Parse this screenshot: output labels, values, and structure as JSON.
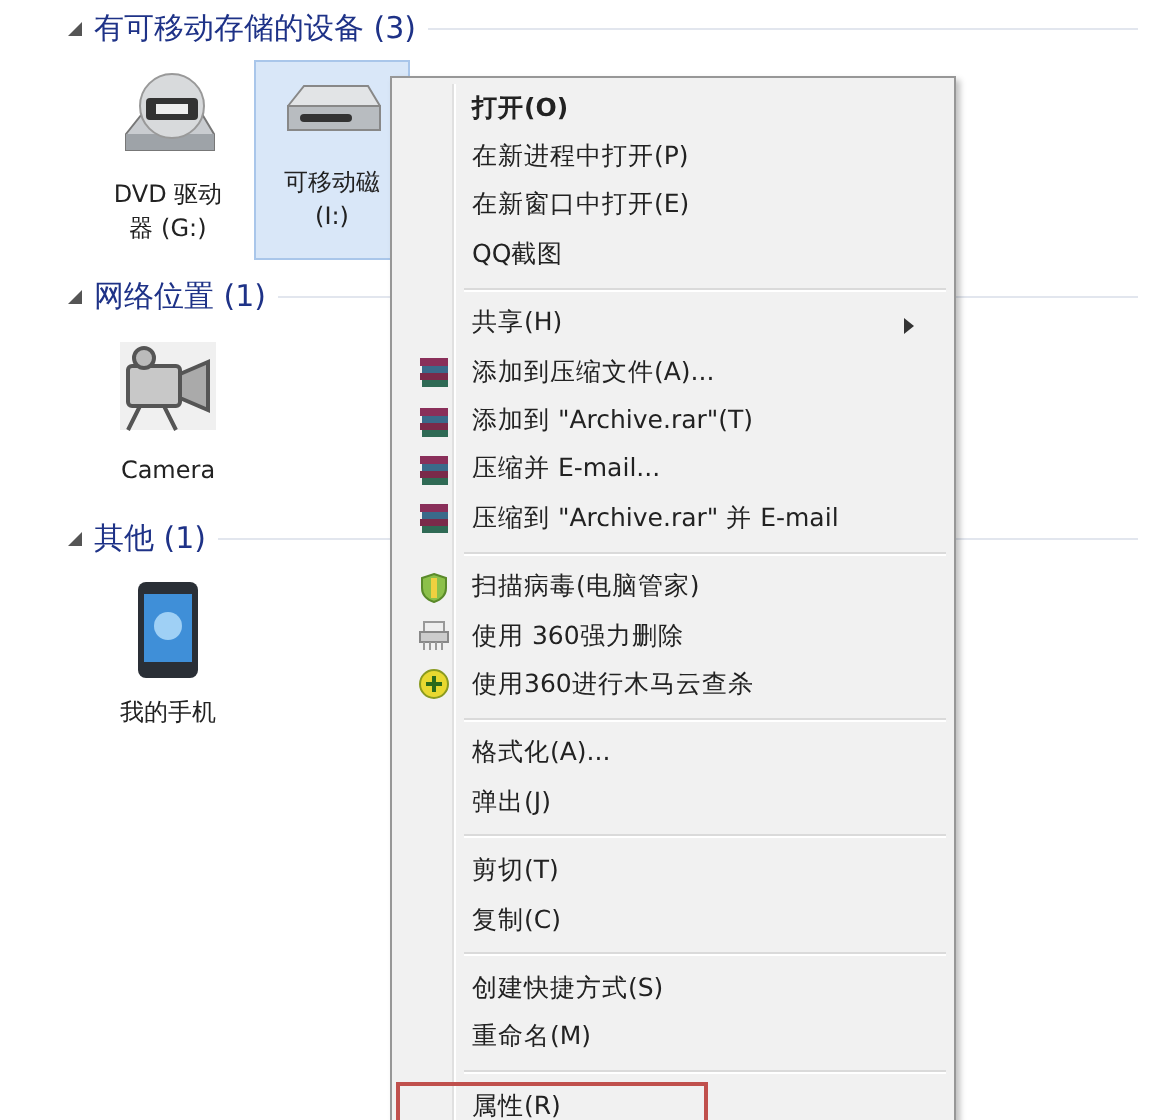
{
  "groups": [
    {
      "title": "有可移动存储的设备 (3)",
      "expanded": true,
      "items": [
        {
          "kind": "dvd",
          "lines": [
            "DVD 驱动",
            "器 (G:)"
          ],
          "selected": false
        },
        {
          "kind": "drive",
          "lines": [
            "可移动磁",
            "(I:)"
          ],
          "selected": true
        }
      ]
    },
    {
      "title": "网络位置 (1)",
      "expanded": true,
      "items": [
        {
          "kind": "camera",
          "lines": [
            "Camera"
          ],
          "selected": false
        }
      ]
    },
    {
      "title": "其他 (1)",
      "expanded": true,
      "items": [
        {
          "kind": "phone",
          "lines": [
            "我的手机"
          ],
          "selected": false
        }
      ]
    }
  ],
  "context_menu": [
    {
      "kind": "command",
      "label": "打开(O)",
      "default": true
    },
    {
      "kind": "command",
      "label": "在新进程中打开(P)"
    },
    {
      "kind": "command",
      "label": "在新窗口中打开(E)"
    },
    {
      "kind": "command",
      "label": "QQ截图"
    },
    {
      "kind": "separator"
    },
    {
      "kind": "command",
      "label": "共享(H)",
      "submenu": true
    },
    {
      "kind": "archive",
      "label": "添加到压缩文件(A)..."
    },
    {
      "kind": "archive",
      "label": "添加到 \"Archive.rar\"(T)"
    },
    {
      "kind": "archive",
      "label": "压缩并 E-mail..."
    },
    {
      "kind": "archive",
      "label": "压缩到 \"Archive.rar\" 并 E-mail"
    },
    {
      "kind": "separator"
    },
    {
      "kind": "shield",
      "label": "扫描病毒(电脑管家)"
    },
    {
      "kind": "shredder",
      "label": "使用 360强力删除"
    },
    {
      "kind": "plus",
      "label": "使用360进行木马云查杀"
    },
    {
      "kind": "separator"
    },
    {
      "kind": "command",
      "label": "格式化(A)..."
    },
    {
      "kind": "command",
      "label": "弹出(J)"
    },
    {
      "kind": "separator"
    },
    {
      "kind": "command",
      "label": "剪切(T)"
    },
    {
      "kind": "command",
      "label": "复制(C)"
    },
    {
      "kind": "separator"
    },
    {
      "kind": "command",
      "label": "创建快捷方式(S)"
    },
    {
      "kind": "command",
      "label": "重命名(M)"
    },
    {
      "kind": "separator"
    },
    {
      "kind": "command",
      "label": "属性(R)",
      "highlighted": true
    }
  ]
}
